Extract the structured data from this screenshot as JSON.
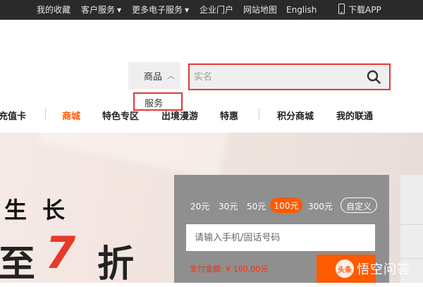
{
  "topbar": {
    "favorites": "我的收藏",
    "customer_service": "客户服务",
    "more_services": "更多电子服务",
    "enterprise": "企业门户",
    "sitemap": "网站地图",
    "english": "English",
    "download_app": "下载APP"
  },
  "search": {
    "category": "商品",
    "placeholder": "实名",
    "dropdown_option": "服务"
  },
  "nav": {
    "items": [
      "充值卡",
      "商城",
      "特色专区",
      "出境漫游",
      "特惠",
      "积分商城",
      "我的联通"
    ],
    "active": "商城"
  },
  "banner": {
    "line1": "生长",
    "line2_prefix": "至",
    "line2_number": "7",
    "line2_suffix": "折"
  },
  "recharge": {
    "amounts": [
      "20元",
      "30元",
      "50元",
      "100元",
      "300元"
    ],
    "selected": "100元",
    "custom": "自定义",
    "phone_placeholder": "请输入手机/固话号码",
    "pay_label": "支付金额: ¥",
    "pay_amount": "100.00元"
  },
  "watermark": {
    "text": "悟空问答",
    "badge": "头条"
  },
  "colors": {
    "accent": "#ff5a00",
    "highlight_box": "#e53935",
    "topbar_bg": "#2a2a2a",
    "panel_bg": "#8f8f8f"
  }
}
